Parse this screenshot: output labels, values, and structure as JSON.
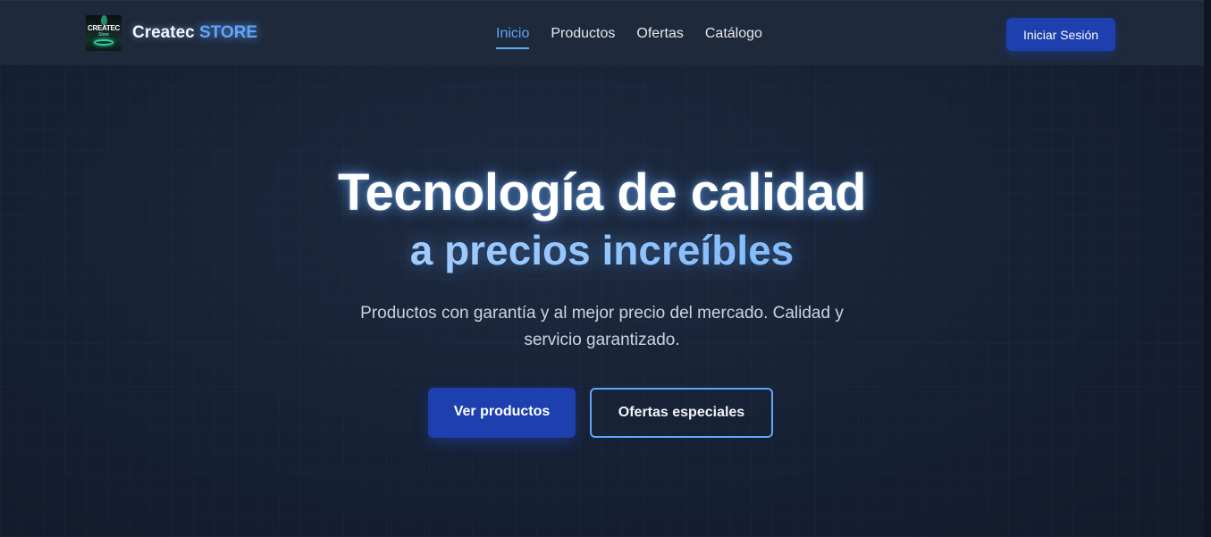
{
  "header": {
    "brand": {
      "name": "Createc",
      "accent": "STORE",
      "logo_text": "CREATEC",
      "logo_subtext": "Store"
    },
    "nav": [
      {
        "label": "Inicio",
        "active": true
      },
      {
        "label": "Productos",
        "active": false
      },
      {
        "label": "Ofertas",
        "active": false
      },
      {
        "label": "Catálogo",
        "active": false
      }
    ],
    "login_label": "Iniciar Sesión"
  },
  "hero": {
    "title": "Tecnología de calidad",
    "subtitle": "a precios increíbles",
    "description": "Productos con garantía y al mejor precio del mercado. Calidad y servicio garantizado.",
    "primary_cta": "Ver productos",
    "secondary_cta": "Ofertas especiales"
  },
  "colors": {
    "background": "#172236",
    "header_bg": "#1e293b",
    "accent": "#60a5fa",
    "button_primary": "#1e40af"
  }
}
